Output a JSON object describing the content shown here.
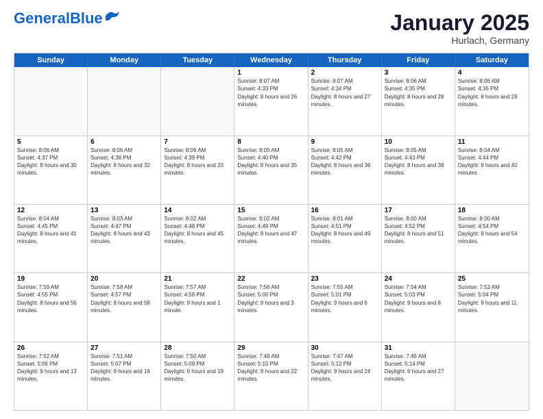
{
  "logo": {
    "line1": "General",
    "line2": "Blue"
  },
  "title": "January 2025",
  "location": "Hurlach, Germany",
  "header_days": [
    "Sunday",
    "Monday",
    "Tuesday",
    "Wednesday",
    "Thursday",
    "Friday",
    "Saturday"
  ],
  "weeks": [
    [
      {
        "day": "",
        "info": ""
      },
      {
        "day": "",
        "info": ""
      },
      {
        "day": "",
        "info": ""
      },
      {
        "day": "1",
        "info": "Sunrise: 8:07 AM\nSunset: 4:33 PM\nDaylight: 8 hours and 26 minutes."
      },
      {
        "day": "2",
        "info": "Sunrise: 8:07 AM\nSunset: 4:34 PM\nDaylight: 8 hours and 27 minutes."
      },
      {
        "day": "3",
        "info": "Sunrise: 8:06 AM\nSunset: 4:35 PM\nDaylight: 8 hours and 28 minutes."
      },
      {
        "day": "4",
        "info": "Sunrise: 8:06 AM\nSunset: 4:36 PM\nDaylight: 8 hours and 29 minutes."
      }
    ],
    [
      {
        "day": "5",
        "info": "Sunrise: 8:06 AM\nSunset: 4:37 PM\nDaylight: 8 hours and 30 minutes."
      },
      {
        "day": "6",
        "info": "Sunrise: 8:06 AM\nSunset: 4:38 PM\nDaylight: 8 hours and 32 minutes."
      },
      {
        "day": "7",
        "info": "Sunrise: 8:06 AM\nSunset: 4:39 PM\nDaylight: 8 hours and 33 minutes."
      },
      {
        "day": "8",
        "info": "Sunrise: 8:05 AM\nSunset: 4:40 PM\nDaylight: 8 hours and 35 minutes."
      },
      {
        "day": "9",
        "info": "Sunrise: 8:05 AM\nSunset: 4:42 PM\nDaylight: 8 hours and 36 minutes."
      },
      {
        "day": "10",
        "info": "Sunrise: 8:05 AM\nSunset: 4:43 PM\nDaylight: 8 hours and 38 minutes."
      },
      {
        "day": "11",
        "info": "Sunrise: 8:04 AM\nSunset: 4:44 PM\nDaylight: 8 hours and 40 minutes."
      }
    ],
    [
      {
        "day": "12",
        "info": "Sunrise: 8:04 AM\nSunset: 4:45 PM\nDaylight: 8 hours and 41 minutes."
      },
      {
        "day": "13",
        "info": "Sunrise: 8:03 AM\nSunset: 4:47 PM\nDaylight: 8 hours and 43 minutes."
      },
      {
        "day": "14",
        "info": "Sunrise: 8:02 AM\nSunset: 4:48 PM\nDaylight: 8 hours and 45 minutes."
      },
      {
        "day": "15",
        "info": "Sunrise: 8:02 AM\nSunset: 4:49 PM\nDaylight: 8 hours and 47 minutes."
      },
      {
        "day": "16",
        "info": "Sunrise: 8:01 AM\nSunset: 4:51 PM\nDaylight: 8 hours and 49 minutes."
      },
      {
        "day": "17",
        "info": "Sunrise: 8:00 AM\nSunset: 4:52 PM\nDaylight: 8 hours and 51 minutes."
      },
      {
        "day": "18",
        "info": "Sunrise: 8:00 AM\nSunset: 4:54 PM\nDaylight: 8 hours and 54 minutes."
      }
    ],
    [
      {
        "day": "19",
        "info": "Sunrise: 7:59 AM\nSunset: 4:55 PM\nDaylight: 8 hours and 56 minutes."
      },
      {
        "day": "20",
        "info": "Sunrise: 7:58 AM\nSunset: 4:57 PM\nDaylight: 8 hours and 58 minutes."
      },
      {
        "day": "21",
        "info": "Sunrise: 7:57 AM\nSunset: 4:58 PM\nDaylight: 9 hours and 1 minute."
      },
      {
        "day": "22",
        "info": "Sunrise: 7:56 AM\nSunset: 5:00 PM\nDaylight: 9 hours and 3 minutes."
      },
      {
        "day": "23",
        "info": "Sunrise: 7:55 AM\nSunset: 5:01 PM\nDaylight: 9 hours and 6 minutes."
      },
      {
        "day": "24",
        "info": "Sunrise: 7:54 AM\nSunset: 5:03 PM\nDaylight: 9 hours and 8 minutes."
      },
      {
        "day": "25",
        "info": "Sunrise: 7:53 AM\nSunset: 5:04 PM\nDaylight: 9 hours and 11 minutes."
      }
    ],
    [
      {
        "day": "26",
        "info": "Sunrise: 7:52 AM\nSunset: 5:06 PM\nDaylight: 9 hours and 13 minutes."
      },
      {
        "day": "27",
        "info": "Sunrise: 7:51 AM\nSunset: 5:07 PM\nDaylight: 9 hours and 16 minutes."
      },
      {
        "day": "28",
        "info": "Sunrise: 7:50 AM\nSunset: 5:09 PM\nDaylight: 9 hours and 19 minutes."
      },
      {
        "day": "29",
        "info": "Sunrise: 7:48 AM\nSunset: 5:10 PM\nDaylight: 9 hours and 22 minutes."
      },
      {
        "day": "30",
        "info": "Sunrise: 7:47 AM\nSunset: 5:12 PM\nDaylight: 9 hours and 24 minutes."
      },
      {
        "day": "31",
        "info": "Sunrise: 7:46 AM\nSunset: 5:14 PM\nDaylight: 9 hours and 27 minutes."
      },
      {
        "day": "",
        "info": ""
      }
    ]
  ]
}
